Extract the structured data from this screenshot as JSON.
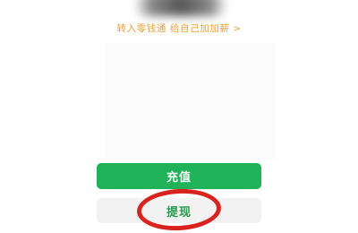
{
  "balance": {
    "amount_obscured": ""
  },
  "promo": {
    "text": "转入零钱通 给自己加加薪",
    "chevron": ">"
  },
  "actions": {
    "recharge_label": "充值",
    "withdraw_label": "提现"
  },
  "colors": {
    "primary_green": "#1fb258",
    "promo_orange": "#e8a23a",
    "annotation_red": "#d9231f",
    "secondary_bg": "#f2f2f2"
  },
  "annotation": {
    "shape": "circle",
    "highlighted_target": "withdraw-button"
  }
}
